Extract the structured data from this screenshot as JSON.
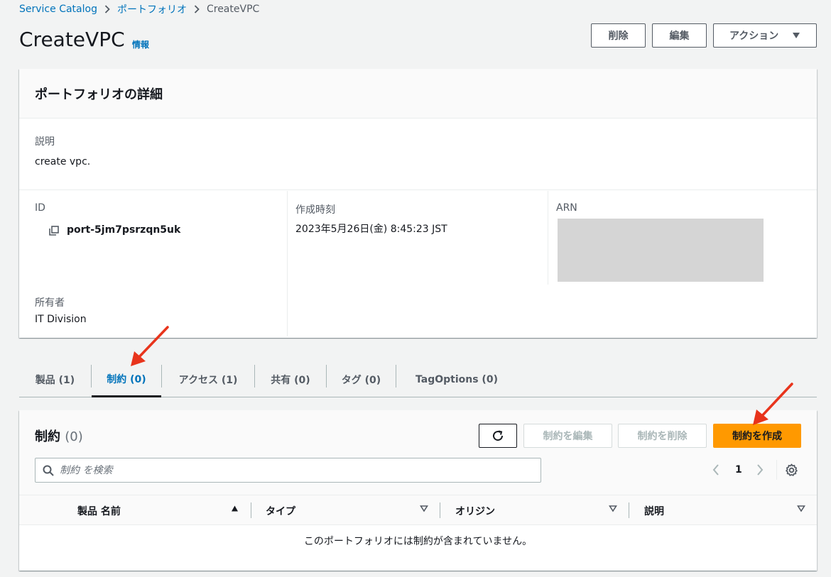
{
  "breadcrumb": {
    "items": [
      "Service Catalog",
      "ポートフォリオ"
    ],
    "current": "CreateVPC"
  },
  "header": {
    "title": "CreateVPC",
    "info_link": "情報",
    "actions": {
      "delete": "削除",
      "edit": "編集",
      "actions_menu": "アクション"
    }
  },
  "details": {
    "panel_title": "ポートフォリオの詳細",
    "description_label": "説明",
    "description_value": "create vpc.",
    "id_label": "ID",
    "id_value": "port-5jm7psrzqn5uk",
    "created_label": "作成時刻",
    "created_value": "2023年5月26日(金) 8:45:23 JST",
    "arn_label": "ARN",
    "owner_label": "所有者",
    "owner_value": "IT Division"
  },
  "tabs": [
    {
      "label": "製品 (1)",
      "active": false
    },
    {
      "label": "制約 (0)",
      "active": true
    },
    {
      "label": "アクセス (1)",
      "active": false
    },
    {
      "label": "共有 (0)",
      "active": false
    },
    {
      "label": "タグ (0)",
      "active": false
    },
    {
      "label": "TagOptions (0)",
      "active": false
    }
  ],
  "constraints": {
    "title": "制約",
    "count": "(0)",
    "edit_button": "制約を編集",
    "delete_button": "制約を削除",
    "create_button": "制約を作成",
    "search_placeholder": "制約 を検索",
    "pagination": {
      "current_page": "1"
    },
    "columns": [
      "製品 名前",
      "タイプ",
      "オリジン",
      "説明"
    ],
    "empty_message": "このポートフォリオには制約が含まれていません。"
  },
  "colors": {
    "link": "#0073bb",
    "primary": "#ff9900",
    "annotation_arrow": "#e8341c"
  }
}
